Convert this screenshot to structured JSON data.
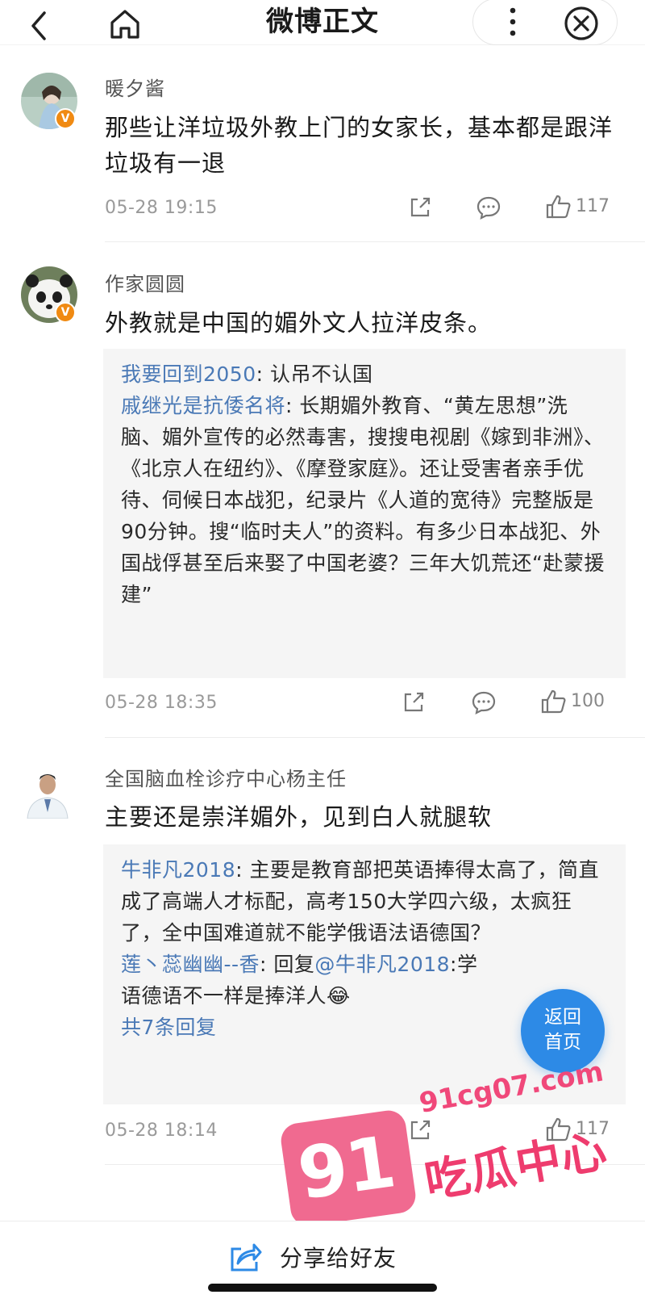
{
  "header": {
    "title": "微博正文",
    "back_icon": "chevron-left-icon",
    "home_icon": "home-icon",
    "more_icon": "more-vertical-icon",
    "close_icon": "close-circle-icon"
  },
  "comments": [
    {
      "username": "暖夕酱",
      "text": "那些让洋垃圾外教上门的女家长，基本都是跟洋垃圾有一退",
      "time": "05-28 19:15",
      "likes": "117",
      "verified": "V",
      "replies": []
    },
    {
      "username": "作家圆圆",
      "text": "外教就是中国的媚外文人拉洋皮条。",
      "time": "05-28 18:35",
      "likes": "100",
      "verified": "V",
      "replies": [
        {
          "user": "我要回到2050",
          "text": ": 认吊不认国"
        },
        {
          "user": "戚继光是抗倭名将",
          "text": ": 长期媚外教育、“黄左思想”洗脑、媚外宣传的必然毒害，搜搜电视剧《嫁到非洲》、《北京人在纽约》、《摩登家庭》。还让受害者亲手优待、伺候日本战犯，纪录片《人道的宽待》完整版是90分钟。搜“临时夫人”的资料。有多少日本战犯、外国战俘甚至后来娶了中国老婆？三年大饥荒还“赴蒙援建”"
        }
      ]
    },
    {
      "username": "全国脑血栓诊疗中心杨主任",
      "text": "主要还是崇洋媚外，见到白人就腿软",
      "time": "05-28 18:14",
      "likes": "117",
      "replies": [
        {
          "user": "牛非凡2018",
          "text": ": 主要是教育部把英语捧得太高了，简直成了高端人才标配，高考150大学四六级，太疯狂了，全中国难道就不能学俄语法语德国？"
        },
        {
          "user": "莲丶蕊幽幽--香",
          "text": ": 回复",
          "mention": "@牛非凡2018",
          "text2": ":学",
          "text3": "语德语不一样是捧洋人",
          "emoji": "😂"
        }
      ],
      "more_replies": "共7条回复"
    }
  ],
  "float_button": {
    "line1": "返回",
    "line2": "首页"
  },
  "watermark": {
    "badge": "91",
    "domain": "91cg07.com",
    "slogan": "吃瓜中心"
  },
  "footer": {
    "share_label": "分享给好友",
    "share_icon": "share-icon"
  },
  "colors": {
    "link": "#4a79b6",
    "accent": "#2d8ae6",
    "verified": "#f08a12",
    "watermark": "#ee3c6e"
  }
}
